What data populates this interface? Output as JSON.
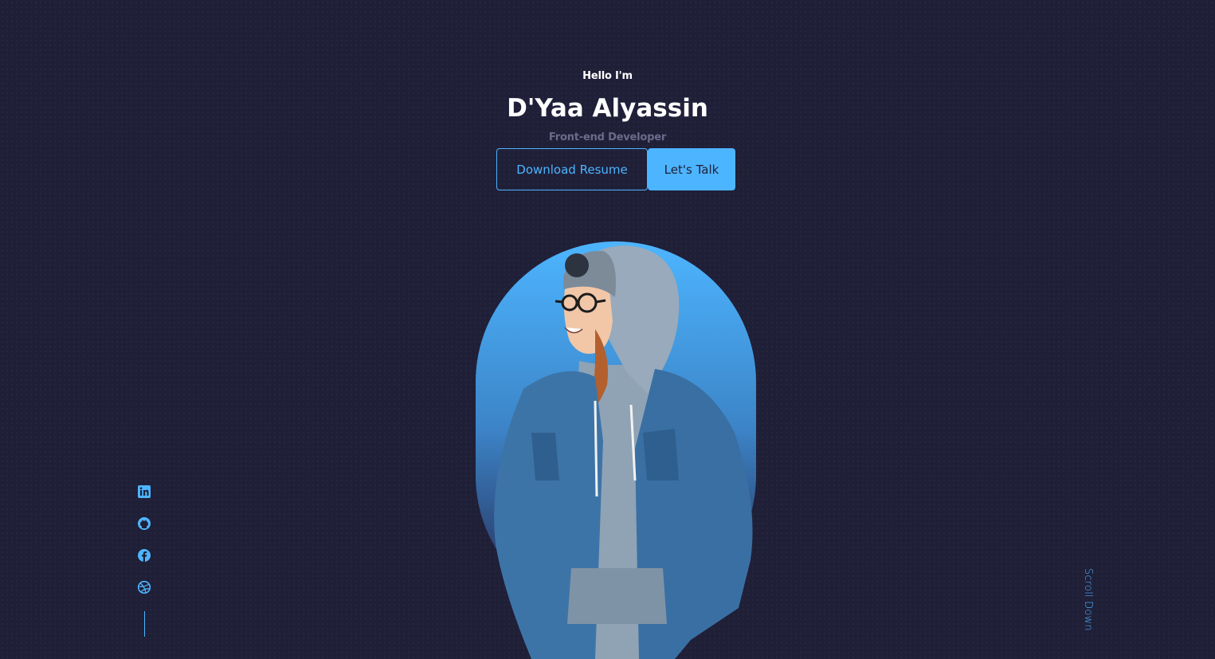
{
  "header": {
    "greeting": "Hello I'm",
    "name": "D'Yaa Alyassin",
    "role": "Front-end Developer"
  },
  "cta": {
    "download_label": "Download Resume",
    "talk_label": "Let's Talk"
  },
  "socials": [
    {
      "icon": "linkedin-icon"
    },
    {
      "icon": "github-icon"
    },
    {
      "icon": "facebook-icon"
    },
    {
      "icon": "dribbble-icon"
    }
  ],
  "scroll": {
    "label": "Scroll Down"
  },
  "colors": {
    "background": "#1f1f38",
    "accent": "#4db5ff",
    "muted": "#6b6b8a"
  }
}
